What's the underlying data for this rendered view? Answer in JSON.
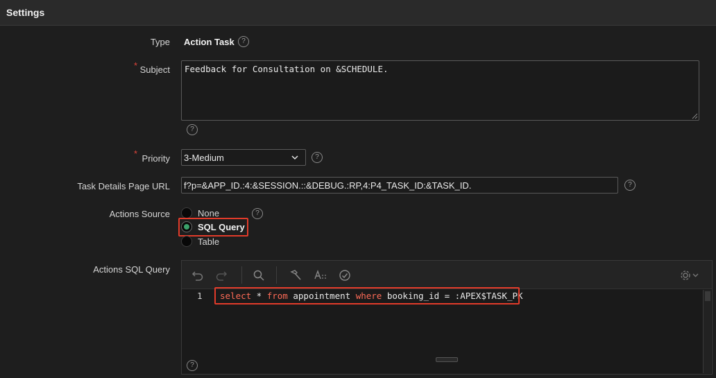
{
  "header": {
    "title": "Settings"
  },
  "type": {
    "label": "Type",
    "value": "Action Task"
  },
  "subject": {
    "required_mark": "*",
    "label": "Subject",
    "value": "Feedback for Consultation on &SCHEDULE."
  },
  "priority": {
    "required_mark": "*",
    "label": "Priority",
    "selected": "3-Medium"
  },
  "task_details": {
    "label": "Task Details Page URL",
    "value": "f?p=&APP_ID.:4:&SESSION.::&DEBUG.:RP,4:P4_TASK_ID:&TASK_ID."
  },
  "actions_source": {
    "label": "Actions Source",
    "options": [
      {
        "label": "None",
        "checked": false
      },
      {
        "label": "SQL Query",
        "checked": true
      },
      {
        "label": "Table",
        "checked": false
      }
    ]
  },
  "actions_sql": {
    "label": "Actions SQL Query",
    "line_number": "1",
    "code": {
      "t1": "select",
      "t2": " * ",
      "t3": "from",
      "t4": " appointment ",
      "t5": "where",
      "t6": " booking_id = :APEX$TASK_PK"
    }
  },
  "help_glyph": "?",
  "colors": {
    "accent_red": "#e23b2a",
    "keyword": "#ff6b57",
    "radio_checked": "#3aa06a"
  }
}
